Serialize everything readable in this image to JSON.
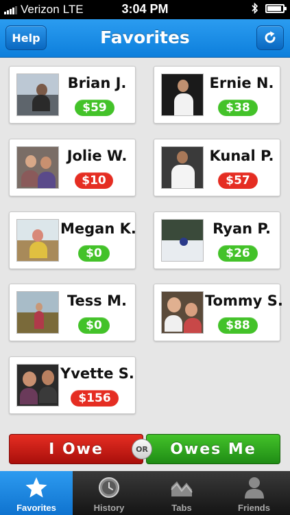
{
  "status_bar": {
    "carrier": "Verizon",
    "network": "LTE",
    "time": "3:04 PM"
  },
  "header": {
    "title": "Favorites",
    "help_label": "Help"
  },
  "colors": {
    "owe_red": "#e52d22",
    "owed_green": "#43c229",
    "brand_blue": "#0d7fdc"
  },
  "favorites": [
    {
      "name": "Brian J.",
      "amount": "$59",
      "status": "owed"
    },
    {
      "name": "Ernie N.",
      "amount": "$38",
      "status": "owed"
    },
    {
      "name": "Jolie W.",
      "amount": "$10",
      "status": "owe"
    },
    {
      "name": "Kunal P.",
      "amount": "$57",
      "status": "owe"
    },
    {
      "name": "Megan K.",
      "amount": "$0",
      "status": "owed"
    },
    {
      "name": "Ryan P.",
      "amount": "$26",
      "status": "owed"
    },
    {
      "name": "Tess M.",
      "amount": "$0",
      "status": "owed"
    },
    {
      "name": "Tommy S.",
      "amount": "$88",
      "status": "owed"
    },
    {
      "name": "Yvette S.",
      "amount": "$156",
      "status": "owe"
    }
  ],
  "actions": {
    "i_owe_label": "I Owe",
    "or_label": "OR",
    "owes_me_label": "Owes Me"
  },
  "tabs": [
    {
      "label": "Favorites",
      "icon": "star-icon",
      "active": true
    },
    {
      "label": "History",
      "icon": "clock-icon",
      "active": false
    },
    {
      "label": "Tabs",
      "icon": "chart-icon",
      "active": false
    },
    {
      "label": "Friends",
      "icon": "person-icon",
      "active": false
    }
  ]
}
